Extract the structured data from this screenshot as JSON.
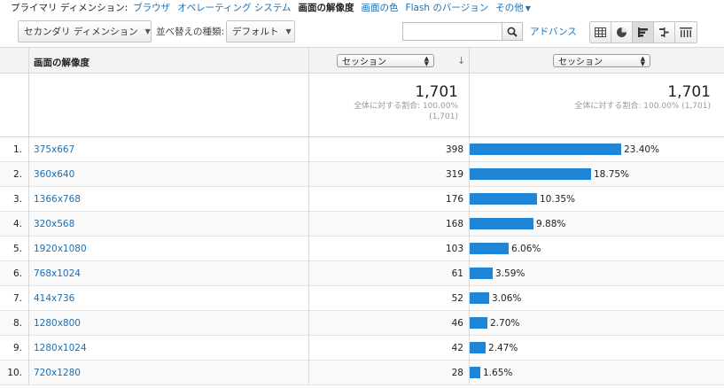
{
  "primary_dimension": {
    "label": "プライマリ ディメンション:",
    "options": [
      {
        "label": "ブラウザ",
        "active": false
      },
      {
        "label": "オペレーティング システム",
        "active": false
      },
      {
        "label": "画面の解像度",
        "active": true
      },
      {
        "label": "画面の色",
        "active": false
      },
      {
        "label": "Flash のバージョン",
        "active": false
      },
      {
        "label": "その他",
        "active": false
      }
    ]
  },
  "toolbar": {
    "secondary_dimension": "セカンダリ ディメンション",
    "sort_label": "並べ替えの種類:",
    "sort_value": "デフォルト",
    "search_value": "",
    "advanced": "アドバンス",
    "views": [
      "table-view",
      "pie-view",
      "performance-view",
      "comparison-view",
      "pivot-view"
    ],
    "active_view": "performance-view"
  },
  "table": {
    "dimension_header": "画面の解像度",
    "metric_left": "セッション",
    "metric_right": "セッション",
    "totals": {
      "left_value": "1,701",
      "left_pct_line1": "全体に対する割合: 100.00%",
      "left_pct_line2": "(1,701)",
      "right_value": "1,701",
      "right_pct": "全体に対する割合: 100.00% (1,701)"
    },
    "rows": [
      {
        "index": "1.",
        "resolution": "375x667",
        "sessions": "398",
        "percent": "23.40%",
        "share": 23.4
      },
      {
        "index": "2.",
        "resolution": "360x640",
        "sessions": "319",
        "percent": "18.75%",
        "share": 18.75
      },
      {
        "index": "3.",
        "resolution": "1366x768",
        "sessions": "176",
        "percent": "10.35%",
        "share": 10.35
      },
      {
        "index": "4.",
        "resolution": "320x568",
        "sessions": "168",
        "percent": "9.88%",
        "share": 9.88
      },
      {
        "index": "5.",
        "resolution": "1920x1080",
        "sessions": "103",
        "percent": "6.06%",
        "share": 6.06
      },
      {
        "index": "6.",
        "resolution": "768x1024",
        "sessions": "61",
        "percent": "3.59%",
        "share": 3.59
      },
      {
        "index": "7.",
        "resolution": "414x736",
        "sessions": "52",
        "percent": "3.06%",
        "share": 3.06
      },
      {
        "index": "8.",
        "resolution": "1280x800",
        "sessions": "46",
        "percent": "2.70%",
        "share": 2.7
      },
      {
        "index": "9.",
        "resolution": "1280x1024",
        "sessions": "42",
        "percent": "2.47%",
        "share": 2.47
      },
      {
        "index": "10.",
        "resolution": "720x1280",
        "sessions": "28",
        "percent": "1.65%",
        "share": 1.65
      }
    ]
  },
  "colors": {
    "bar": "#1f85d6",
    "link": "#1a6fb5"
  }
}
